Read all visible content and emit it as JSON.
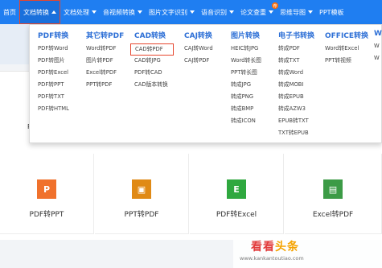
{
  "nav": {
    "items": [
      {
        "label": "首页",
        "caret": false
      },
      {
        "label": "文档转换",
        "caret": true,
        "active": true
      },
      {
        "label": "文档处理",
        "caret": true
      },
      {
        "label": "音视频转换",
        "caret": true
      },
      {
        "label": "图片文字识别",
        "caret": true
      },
      {
        "label": "语音识别",
        "caret": true
      },
      {
        "label": "论文查重",
        "caret": true,
        "badge": "荐"
      },
      {
        "label": "思维导图",
        "caret": true
      },
      {
        "label": "PPT模板",
        "caret": false
      }
    ],
    "color": "#1f7ef1"
  },
  "dropdown": {
    "columns": [
      {
        "title": "PDF转换",
        "links": [
          "PDF转Word",
          "PDF转图片",
          "PDF转Excel",
          "PDF转PPT",
          "PDF转TXT",
          "PDF转HTML"
        ]
      },
      {
        "title": "其它转PDF",
        "links": [
          "Word转PDF",
          "图片转PDF",
          "Excel转PDF",
          "PPT转PDF"
        ]
      },
      {
        "title": "CAD转换",
        "links": [
          "CAD转PDF",
          "CAD转JPG",
          "PDF转CAD",
          "CAD版本转换"
        ]
      },
      {
        "title": "CAJ转换",
        "links": [
          "CAJ转Word",
          "CAJ转PDF"
        ]
      },
      {
        "title": "图片转换",
        "links": [
          "HEIC转JPG",
          "Word转长图",
          "PPT转长图",
          "转成JPG",
          "转成PNG",
          "转成BMP",
          "转成ICON"
        ]
      },
      {
        "title": "电子书转换",
        "links": [
          "转成PDF",
          "转成TXT",
          "转成Word",
          "转成MOBI",
          "转成EPUB",
          "转成AZW3",
          "EPUB转TXT",
          "TXT转EPUB"
        ]
      },
      {
        "title": "OFFICE转换",
        "links": [
          "Word转Excel",
          "PPT转视频"
        ]
      },
      {
        "title": "W",
        "links": [
          "W",
          "W"
        ]
      }
    ]
  },
  "tiles": [
    {
      "label": "PDF转PPT",
      "icon": "P",
      "color": "#f0712c"
    },
    {
      "label": "PPT转PDF",
      "icon": "▣",
      "color": "#e08a16"
    },
    {
      "label": "PDF转Excel",
      "icon": "E",
      "color": "#2fa83f"
    },
    {
      "label": "Excel转PDF",
      "icon": "▤",
      "color": "#3c9b46"
    }
  ],
  "partial_labels": [
    "PD",
    "Ex"
  ],
  "watermark": {
    "title_a": "看看",
    "title_b": "头条",
    "url": "www.kankantoutiao.com"
  }
}
